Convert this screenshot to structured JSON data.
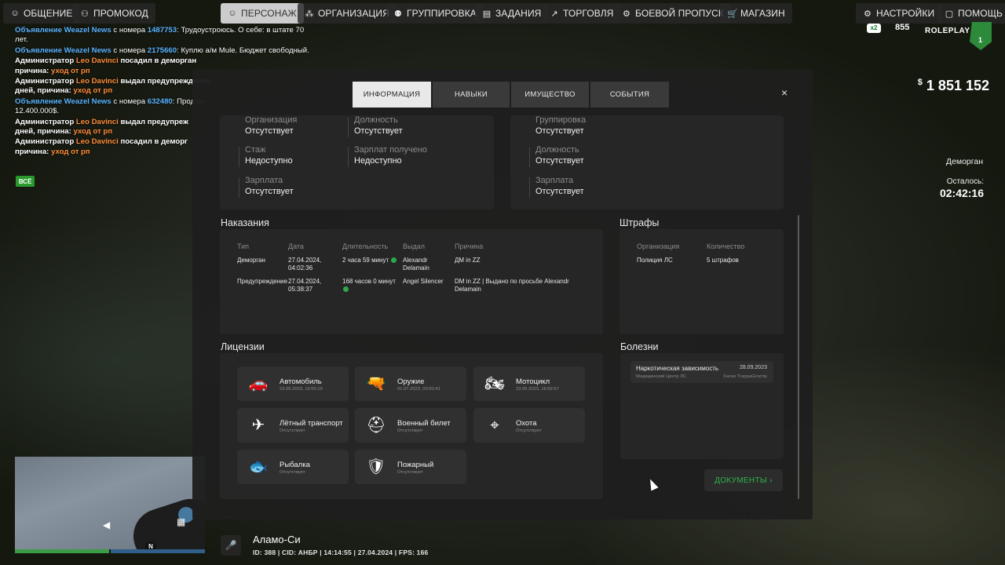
{
  "nav": {
    "left": [
      {
        "label": "ОБЩЕНИЕ",
        "icon": "chat-icon"
      },
      {
        "label": "ПРОМОКОД",
        "icon": "promo-icon"
      }
    ],
    "main": [
      {
        "label": "ПЕРСОНАЖ",
        "icon": "user-icon",
        "active": true
      },
      {
        "label": "ОРГАНИЗАЦИЯ",
        "icon": "organization-icon"
      },
      {
        "label": "ГРУППИРОВКА",
        "icon": "group-icon"
      },
      {
        "label": "ЗАДАНИЯ",
        "icon": "tasks-icon"
      },
      {
        "label": "ТОРГОВЛЯ",
        "icon": "trade-icon"
      },
      {
        "label": "БОЕВОЙ ПРОПУСК",
        "icon": "battlepass-icon"
      },
      {
        "label": "МАГАЗИН",
        "icon": "cart-icon"
      }
    ],
    "right": [
      {
        "label": "НАСТРОЙКИ",
        "icon": "gear-icon"
      },
      {
        "label": "ПОМОЩЬ",
        "icon": "help-icon"
      }
    ]
  },
  "chat": {
    "lines": [
      {
        "prefix": "Объявление Weazel News",
        "mid": "с номера",
        "number": "1487753",
        "text": ": Трудоустроюсь. О себе: в штате 70 лет."
      },
      {
        "prefix": "Объявление Weazel News",
        "mid": "с номера",
        "number": "2175660",
        "text": ": Куплю а/м Mule. Бюджет свободный."
      },
      {
        "prefix": "Администратор",
        "name": "Leo Davinci",
        "text": "посадил в деморган",
        "reason_label": "причина:",
        "reason": "уход от рп"
      },
      {
        "prefix": "Администратор",
        "name": "Leo Davinci",
        "text": "выдал предупреждение",
        "reason_label": "дней, причина:",
        "reason": "уход от рп"
      },
      {
        "prefix": "Объявление Weazel News",
        "mid": "с номера",
        "number": "632480",
        "text": ": Продам",
        "text2": "12.400.000$."
      },
      {
        "prefix": "Администратор",
        "name": "Leo Davinci",
        "text": "выдал предупреж",
        "reason_label": "дней, причина:",
        "reason": "уход от рп"
      },
      {
        "prefix": "Администратор",
        "name": "Leo Davinci",
        "text": "посадил в деморг",
        "reason_label": "причина:",
        "reason": "уход от рп"
      }
    ],
    "badge": "ВСЁ"
  },
  "hud": {
    "x2": "x2",
    "online": "855",
    "rp": "ROLEPLAY",
    "server": "1",
    "money_currency": "$",
    "money": "1 851 152",
    "jail_label": "Деморган",
    "remain_label": "Осталось:",
    "remain_time": "02:42:16"
  },
  "bottom": {
    "location": "Аламо-Си",
    "status": "ID: 388 | CID: АНБР | 14:14:55 | 27.04.2024 | FPS: 166",
    "north": "N"
  },
  "modal": {
    "tabs": [
      {
        "label": "ИНФОРМАЦИЯ",
        "active": true
      },
      {
        "label": "НАВЫКИ"
      },
      {
        "label": "ИМУЩЕСТВО"
      },
      {
        "label": "СОБЫТИЯ"
      }
    ],
    "close": "×",
    "org": {
      "organization_k": "Организация",
      "organization_v": "Отсутствует",
      "position_k": "Должность",
      "position_v": "Отсутствует",
      "tenure_k": "Стаж",
      "tenure_v": "Недоступно",
      "salary_got_k": "Зарплат получено",
      "salary_got_v": "Недоступно",
      "salary_k": "Зарплата",
      "salary_v": "Отсутствует"
    },
    "gang": {
      "group_k": "Группировка",
      "group_v": "Отсутствует",
      "position_k": "Должность",
      "position_v": "Отсутствует",
      "salary_k": "Зарплата",
      "salary_v": "Отсутствует"
    },
    "punishments": {
      "title": "Наказания",
      "headers": [
        "Тип",
        "Дата",
        "Длительность",
        "Выдал",
        "Причина"
      ],
      "rows": [
        {
          "type": "Деморган",
          "date1": "27.04.2024,",
          "date2": "04:02:36",
          "duration": "2 часа 59 минут",
          "by1": "Alexandr",
          "by2": "Delamain",
          "reason1": "ДМ in ZZ",
          "reason2": ""
        },
        {
          "type": "Предупреждение",
          "date1": "27.04.2024,",
          "date2": "05:38:37",
          "duration": "168 часов 0 минут",
          "by1": "Angel Silencer",
          "by2": "",
          "reason1": "DM in ZZ | Выдано по просьбе Alexandr",
          "reason2": "Delamain"
        }
      ]
    },
    "fines": {
      "title": "Штрафы",
      "headers": [
        "Организация",
        "Количество"
      ],
      "rows": [
        {
          "org": "Полиция ЛС",
          "count": "5 штрафов"
        }
      ]
    },
    "licenses": {
      "title": "Лицензии",
      "items": [
        {
          "name": "Автомобиль",
          "date": "23.06.2023, 16:50:19",
          "icon": "car-icon",
          "glyph": "🚗"
        },
        {
          "name": "Оружие",
          "date": "01.07.2023, 03:00:41",
          "icon": "rifle-icon",
          "glyph": "🔫"
        },
        {
          "name": "Мотоцикл",
          "date": "23.06.2023, 16:59:57",
          "icon": "motorcycle-icon",
          "glyph": "🏍"
        },
        {
          "name": "Лётный транспорт",
          "date": "Отсутствует",
          "icon": "plane-icon",
          "glyph": "✈"
        },
        {
          "name": "Военный билет",
          "date": "Отсутствует",
          "icon": "helmet-icon",
          "glyph": "⛑"
        },
        {
          "name": "Охота",
          "date": "Отсутствует",
          "icon": "crosshair-icon",
          "glyph": "⌖"
        },
        {
          "name": "Рыбалка",
          "date": "Отсутствует",
          "icon": "fishing-icon",
          "glyph": "🐟"
        },
        {
          "name": "Пожарный",
          "date": "Отсутствует",
          "icon": "firefighter-icon",
          "glyph": "🛡"
        }
      ]
    },
    "diseases": {
      "title": "Болезни",
      "items": [
        {
          "name": "Наркотическая зависимость",
          "date": "28.09.2023",
          "clinic": "Медицинский Центр ЛС",
          "doctor": "Xanax TrappaGrozniy"
        }
      ]
    },
    "docs_button": "ДОКУМЕНТЫ ›"
  }
}
